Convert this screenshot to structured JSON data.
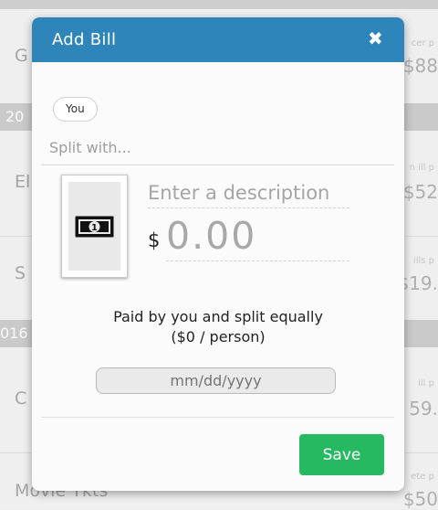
{
  "background": {
    "section_headers": [
      "20",
      "016"
    ],
    "rows": [
      {
        "name": "G",
        "sub": "cer p",
        "amount": "$88"
      },
      {
        "name": "El",
        "sub": "n ill p",
        "amount": "$52"
      },
      {
        "name": "S",
        "sub": "ills p",
        "amount": "$19."
      },
      {
        "name": "C",
        "sub": "ill p",
        "amount": "59."
      },
      {
        "name": "Movie Tkts",
        "sub": "ete p",
        "amount": "$50"
      }
    ]
  },
  "modal": {
    "title": "Add Bill",
    "close_symbol": "✖",
    "chip_label": "You",
    "split_placeholder": "Split with...",
    "description_placeholder": "Enter a description",
    "currency_symbol": "$",
    "amount_placeholder": "0.00",
    "paid_line1": "Paid by you and split equally",
    "paid_line2": "($0 / person)",
    "date_placeholder": "mm/dd/yyyy",
    "save_label": "Save",
    "colors": {
      "header": "#2e85b9",
      "save": "#27b961"
    }
  },
  "icons": {
    "bill": "banknote-icon",
    "close": "close-icon"
  }
}
